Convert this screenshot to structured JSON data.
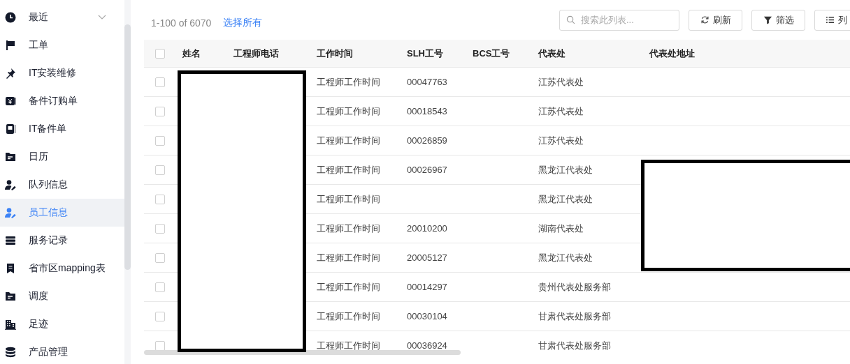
{
  "sidebar": {
    "items": [
      {
        "label": "最近",
        "selected": false,
        "expanded": false
      },
      {
        "label": "工单",
        "selected": false
      },
      {
        "label": "IT安装维修",
        "selected": false
      },
      {
        "label": "备件订购单",
        "selected": false
      },
      {
        "label": "IT备件单",
        "selected": false
      },
      {
        "label": "日历",
        "selected": false
      },
      {
        "label": "队列信息",
        "selected": false
      },
      {
        "label": "员工信息",
        "selected": true
      },
      {
        "label": "服务记录",
        "selected": false
      },
      {
        "label": "省市区mapping表",
        "selected": false
      },
      {
        "label": "调度",
        "selected": false
      },
      {
        "label": "足迹",
        "selected": false
      },
      {
        "label": "产品管理",
        "selected": false
      }
    ]
  },
  "toolbar": {
    "count": "1-100 of 6070",
    "select_all": "选择所有",
    "search": {
      "placeholder": "搜索此列表..."
    },
    "buttons": [
      {
        "label": "刷新"
      },
      {
        "label": "筛选"
      },
      {
        "label": "列"
      }
    ]
  },
  "table": {
    "select_all_checked": false,
    "columns": [
      "姓名",
      "工程师电话",
      "工作时间",
      "SLH工号",
      "BCS工号",
      "代表处",
      "代表处地址"
    ],
    "rows": [
      {
        "work_time": "工程师工作时间",
        "slh_no": "00047763",
        "office": "江苏代表处",
        "checked": false
      },
      {
        "work_time": "工程师工作时间",
        "slh_no": "00018543",
        "office": "江苏代表处",
        "checked": false
      },
      {
        "work_time": "工程师工作时间",
        "slh_no": "00026859",
        "office": "江苏代表处",
        "checked": false
      },
      {
        "work_time": "工程师工作时间",
        "slh_no": "00026967",
        "office": "黑龙江代表处",
        "checked": false
      },
      {
        "work_time": "工程师工作时间",
        "office": "黑龙江代表处",
        "checked": false
      },
      {
        "work_time": "工程师工作时间",
        "slh_no": "20010200",
        "office": "湖南代表处",
        "checked": false
      },
      {
        "work_time": "工程师工作时间",
        "slh_no": "20005127",
        "office": "黑龙江代表处",
        "checked": false
      },
      {
        "work_time": "工程师工作时间",
        "slh_no": "00014297",
        "office": "贵州代表处服务部",
        "checked": false
      },
      {
        "work_time": "工程师工作时间",
        "slh_no": "00030104",
        "office": "甘肃代表处服务部",
        "checked": false
      },
      {
        "work_time": "工程师工作时间",
        "slh_no": "00036924",
        "office": "甘肃代表处服务部",
        "checked": false
      }
    ]
  }
}
